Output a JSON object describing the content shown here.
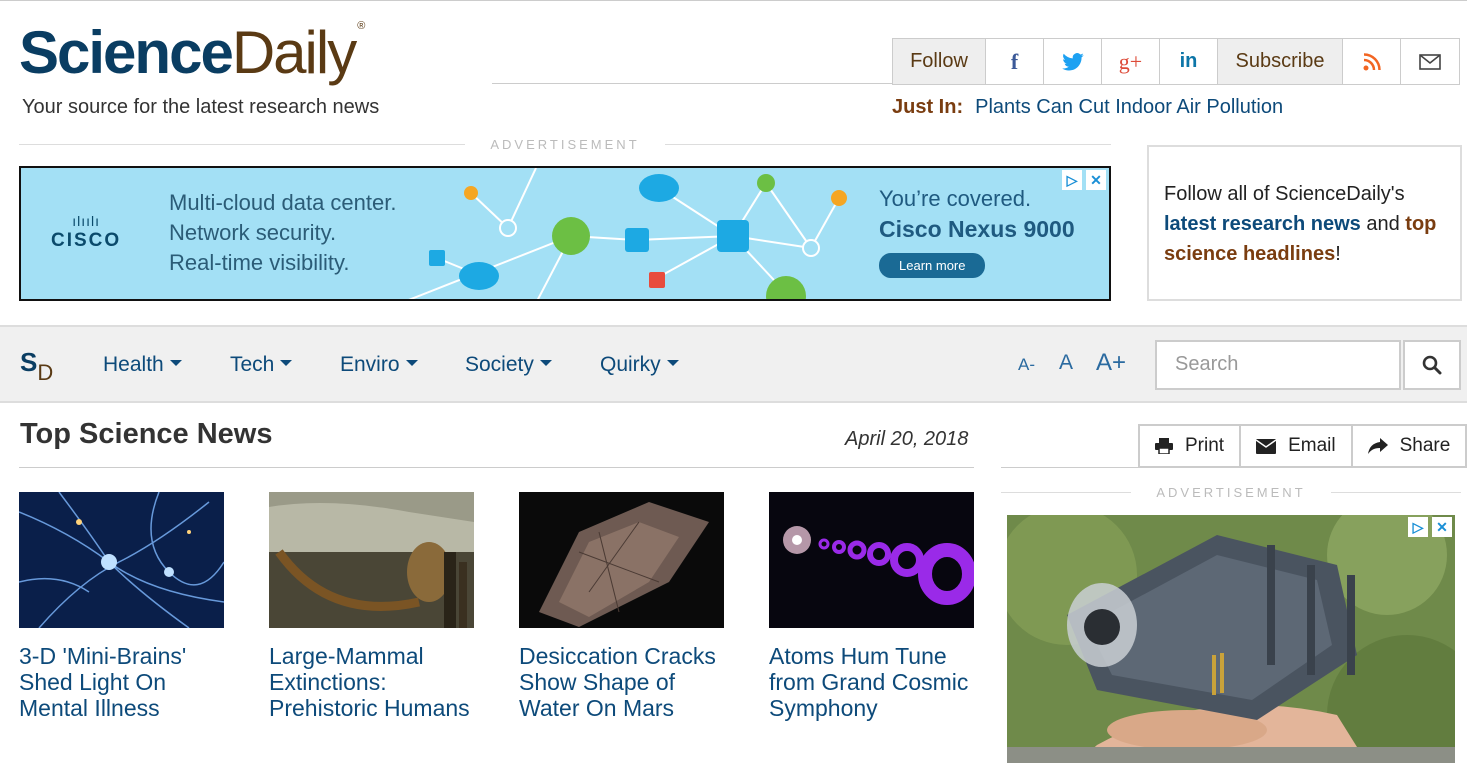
{
  "header": {
    "logo_science": "Science",
    "logo_daily": "Daily",
    "logo_reg": "®",
    "tagline": "Your source for the latest research news",
    "just_in_label": "Just In:",
    "just_in_link": "Plants Can Cut Indoor Air Pollution"
  },
  "social": {
    "follow_label": "Follow",
    "facebook_glyph": "f",
    "twitter_glyph": "🐦",
    "googleplus_glyph": "g+",
    "linkedin_glyph": "in",
    "subscribe_label": "Subscribe"
  },
  "ads": {
    "label": "ADVERTISEMENT",
    "banner": {
      "brand": "CISCO",
      "lines": [
        "Multi-cloud data center.",
        "Network security.",
        "Real-time visibility."
      ],
      "covered": "You’re covered.",
      "product": "Cisco Nexus 9000",
      "cta": "Learn more"
    }
  },
  "follow_box": {
    "text_pre": "Follow all of ScienceDaily's",
    "link1": "latest research news",
    "mid": "and",
    "link2": "top science headlines",
    "end": "!"
  },
  "nav": {
    "logo_s": "S",
    "logo_d": "D",
    "items": [
      "Health",
      "Tech",
      "Enviro",
      "Society",
      "Quirky"
    ],
    "font_small": "A-",
    "font_normal": "A",
    "font_large": "A+",
    "search_placeholder": "Search"
  },
  "main": {
    "title": "Top Science News",
    "date": "April 20, 2018",
    "stories": [
      {
        "headline": "3-D 'Mini-Brains' Shed Light On Mental Illness"
      },
      {
        "headline": "Large-Mammal Extinctions: Prehistoric Humans"
      },
      {
        "headline": "Desiccation Cracks Show Shape of Water On Mars"
      },
      {
        "headline": "Atoms Hum Tune from Grand Cosmic Symphony"
      }
    ]
  },
  "tools": {
    "print": "Print",
    "email": "Email",
    "share": "Share"
  },
  "colors": {
    "brand_blue": "#0a3d62",
    "brand_brown": "#5a3a14",
    "link_blue": "#0d4a7a",
    "ad_bg": "#a3e0f5"
  }
}
